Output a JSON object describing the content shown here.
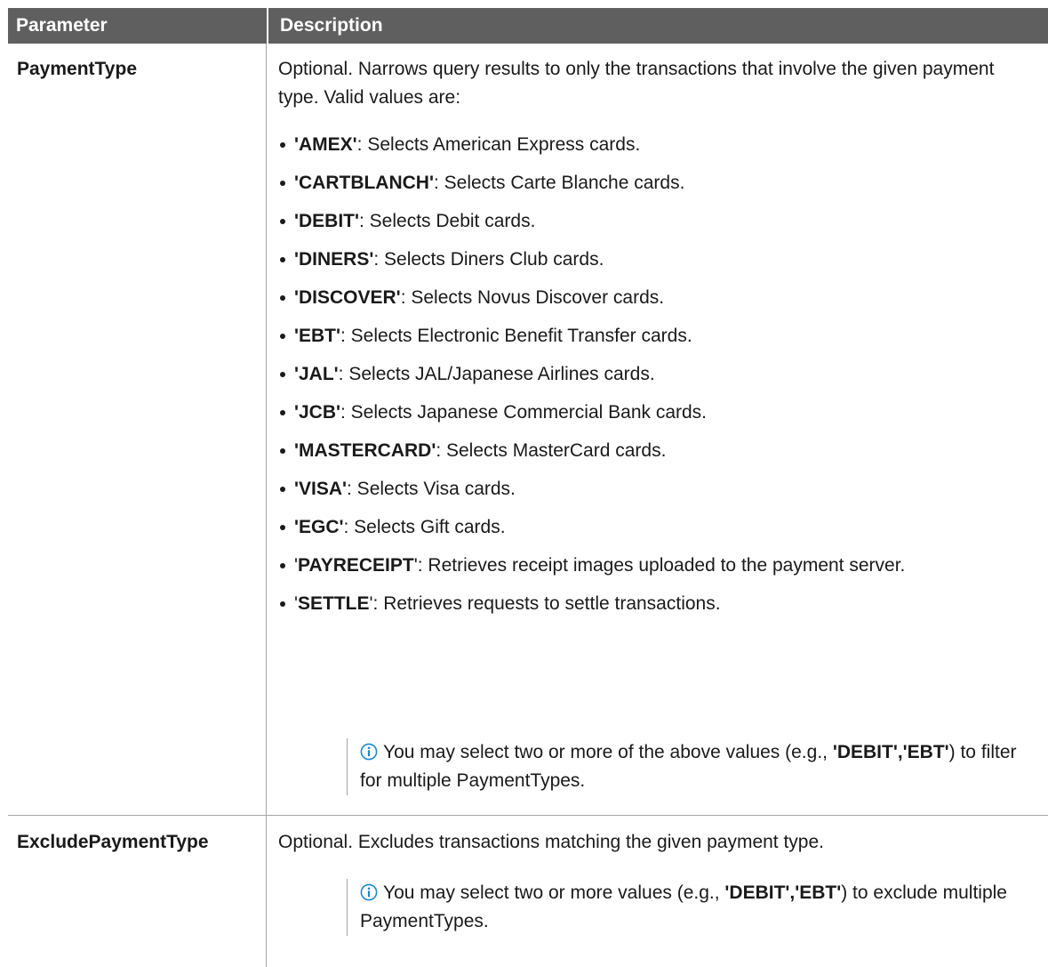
{
  "header": {
    "col_parameter": "Parameter",
    "col_description": "Description"
  },
  "rows": [
    {
      "name": "PaymentType",
      "description": "Optional. Narrows query results to only the transactions that involve the given payment type. Valid values are:",
      "values": [
        {
          "code": "'AMEX'",
          "text": ": Selects American Express cards."
        },
        {
          "code": "'CARTBLANCH'",
          "text": ": Selects Carte Blanche cards."
        },
        {
          "code": "'DEBIT'",
          "text": ": Selects Debit cards."
        },
        {
          "code": "'DINERS'",
          "text": ": Selects Diners Club cards."
        },
        {
          "code": "'DISCOVER'",
          "text": ": Selects Novus Discover cards."
        },
        {
          "code": "'EBT'",
          "text": ": Selects Electronic Benefit Transfer cards."
        },
        {
          "code": "'JAL'",
          "text": ": Selects JAL/Japanese Airlines cards."
        },
        {
          "code": "'JCB'",
          "text": ": Selects Japanese Commercial Bank cards."
        },
        {
          "code": "'MASTERCARD'",
          "text": ": Selects MasterCard cards."
        },
        {
          "code": "'VISA'",
          "text": ": Selects Visa cards."
        },
        {
          "code": "'EGC'",
          "text": ": Selects Gift cards."
        },
        {
          "quote_open": "'",
          "code": "PAYRECEIPT",
          "quote_close": "'",
          "text": ": Retrieves receipt images uploaded to the payment server."
        },
        {
          "quote_open": "'",
          "code": "SETTLE",
          "quote_close": "'",
          "text": ": Retrieves requests to settle transactions."
        }
      ],
      "note": {
        "icon": "info-icon",
        "prefix": "You may select two or more of the above values (e.g., ",
        "example": "'DEBIT','EBT'",
        "suffix": ") to filter for multiple PaymentTypes."
      }
    },
    {
      "name": "ExcludePaymentType",
      "description": "Optional. Excludes transactions matching the given payment type.",
      "note": {
        "icon": "info-icon",
        "prefix": "You may select two or more values (e.g., ",
        "example": "'DEBIT','EBT'",
        "suffix": ") to exclude multiple PaymentTypes."
      }
    }
  ],
  "colors": {
    "header_bg": "#5f5f5f",
    "header_text": "#ffffff",
    "rule": "#a6a6a6",
    "info_icon": "#1e88c8"
  }
}
